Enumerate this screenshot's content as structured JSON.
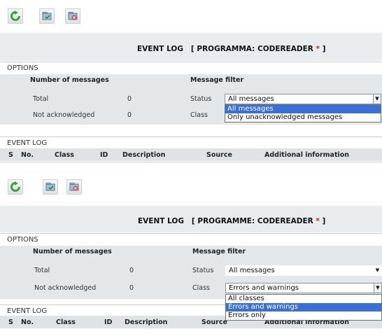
{
  "panels": [
    {
      "title_prefix": "EVENT LOG",
      "title_bracket_open": "[ PROGRAMMA: CODEREADER",
      "title_star": "*",
      "title_bracket_close": "]",
      "options_label": "OPTIONS",
      "number_of_messages_header": "Number of messages",
      "message_filter_header": "Message filter",
      "rows": [
        {
          "label": "Total",
          "count": "0",
          "filter_label": "Status"
        },
        {
          "label": "Not acknowledged",
          "count": "0",
          "filter_label": "Class"
        }
      ],
      "status_select_value": "All messages",
      "status_dropdown_options": [
        "All messages",
        "Only unacknowledged messages"
      ],
      "status_dropdown_selected": "All messages",
      "eventlog_label": "EVENT LOG",
      "columns": [
        "S",
        "No.",
        "Class",
        "ID",
        "Description",
        "Source",
        "Additional information"
      ]
    },
    {
      "title_prefix": "EVENT LOG",
      "title_bracket_open": "[ PROGRAMME: CODEREADER",
      "title_star": "*",
      "title_bracket_close": "]",
      "options_label": "OPTIONS",
      "number_of_messages_header": "Number of messages",
      "message_filter_header": "Message filter",
      "rows": [
        {
          "label": "Total",
          "count": "0",
          "filter_label": "Status"
        },
        {
          "label": "Not acknowledged",
          "count": "0",
          "filter_label": "Class"
        }
      ],
      "status_select_value": "All messages",
      "class_select_value": "Errors and warnings",
      "class_dropdown_options": [
        "All classes",
        "Errors and warnings",
        "Errors only"
      ],
      "class_dropdown_selected": "Errors and warnings",
      "eventlog_label": "EVENT LOG",
      "columns": [
        "S",
        "No.",
        "Class",
        "ID",
        "Description",
        "Source",
        "Additional information"
      ]
    }
  ],
  "toolbar_icons": [
    "refresh-icon",
    "acknowledge-icon",
    "delete-icon"
  ],
  "colors": {
    "refresh": "#3aa53a",
    "star": "#e01818",
    "highlight": "#3a6fd4",
    "options_bg": "#e3e7ea",
    "titlebar_bg": "#e9ecee"
  }
}
